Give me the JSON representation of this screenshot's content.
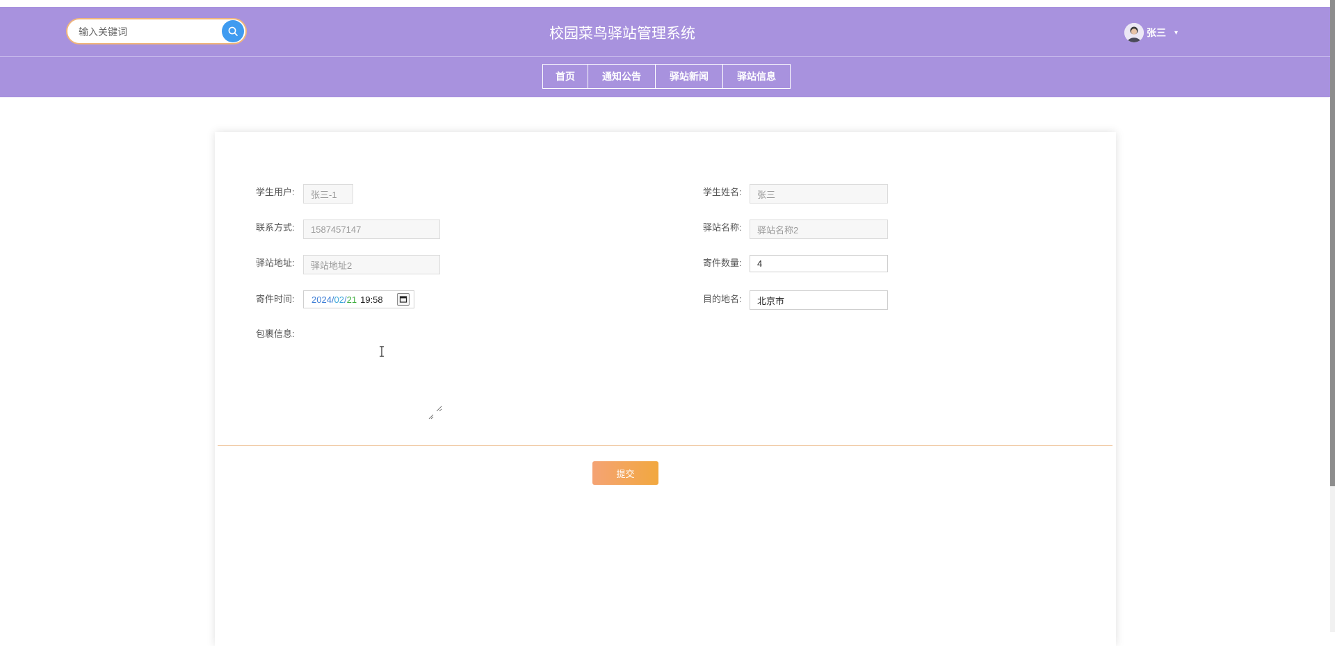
{
  "header": {
    "search_placeholder": "输入关键词",
    "title": "校园菜鸟驿站管理系统",
    "user_name": "张三",
    "caret": "▾"
  },
  "nav": {
    "items": [
      {
        "label": "首页"
      },
      {
        "label": "通知公告"
      },
      {
        "label": "驿站新闻"
      },
      {
        "label": "驿站信息"
      }
    ]
  },
  "form": {
    "student_user": {
      "label": "学生用户:",
      "value": "张三-1"
    },
    "student_name": {
      "label": "学生姓名:",
      "value": "张三"
    },
    "contact": {
      "label": "联系方式:",
      "value": "1587457147"
    },
    "station_name": {
      "label": "驿站名称:",
      "value": "驿站名称2"
    },
    "station_address": {
      "label": "驿站地址:",
      "value": "驿站地址2"
    },
    "send_quantity": {
      "label": "寄件数量:",
      "value": "4"
    },
    "send_time": {
      "label": "寄件时间:",
      "year": "2024",
      "month": "02",
      "day": "21",
      "time": "19:58",
      "slash": "/"
    },
    "destination": {
      "label": "目的地名:",
      "value": "北京市"
    },
    "package_info": {
      "label": "包裹信息:",
      "value": ""
    },
    "submit_label": "提交"
  },
  "colors": {
    "header_bg": "#a892de",
    "search_button": "#3f9bf0",
    "submit_gradient_start": "#f4a374",
    "submit_gradient_end": "#f2a83f"
  }
}
